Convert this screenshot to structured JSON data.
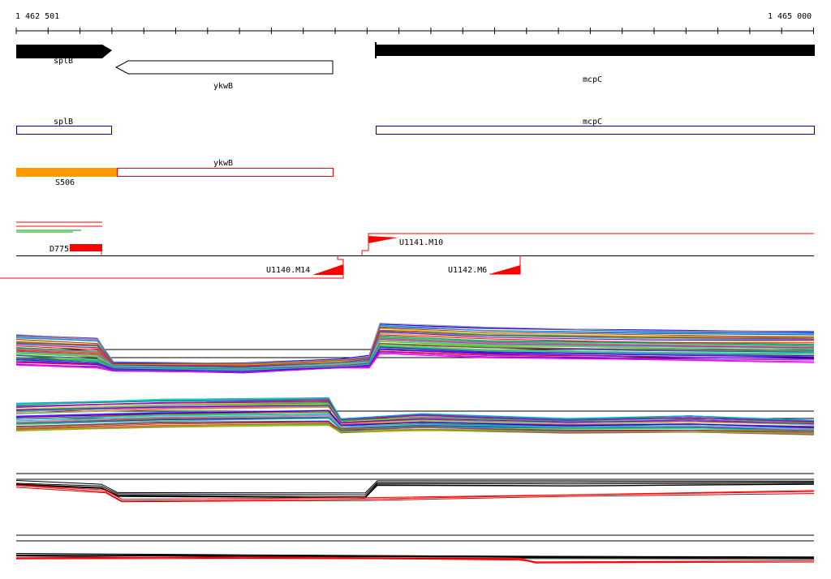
{
  "ruler": {
    "start_label": "1 462 501",
    "end_label": "1 465 000"
  },
  "genes": {
    "splB": "splB",
    "ykwB": "ykwB",
    "mcpC": "mcpC"
  },
  "cds": {
    "splB": "splB",
    "mcpC": "mcpC",
    "ykwB": "ykwB"
  },
  "features": {
    "orange_region": "S506",
    "d_region": "D775"
  },
  "transcripts": {
    "u1140": "U1140.M14",
    "u1141": "U1141.M10",
    "u1142": "U1142.M6"
  },
  "colors": {
    "gene_fill": "#000000",
    "cds_outline": "#0000aa",
    "orange": "#ff9900",
    "transcript_red": "#ff0000"
  }
}
